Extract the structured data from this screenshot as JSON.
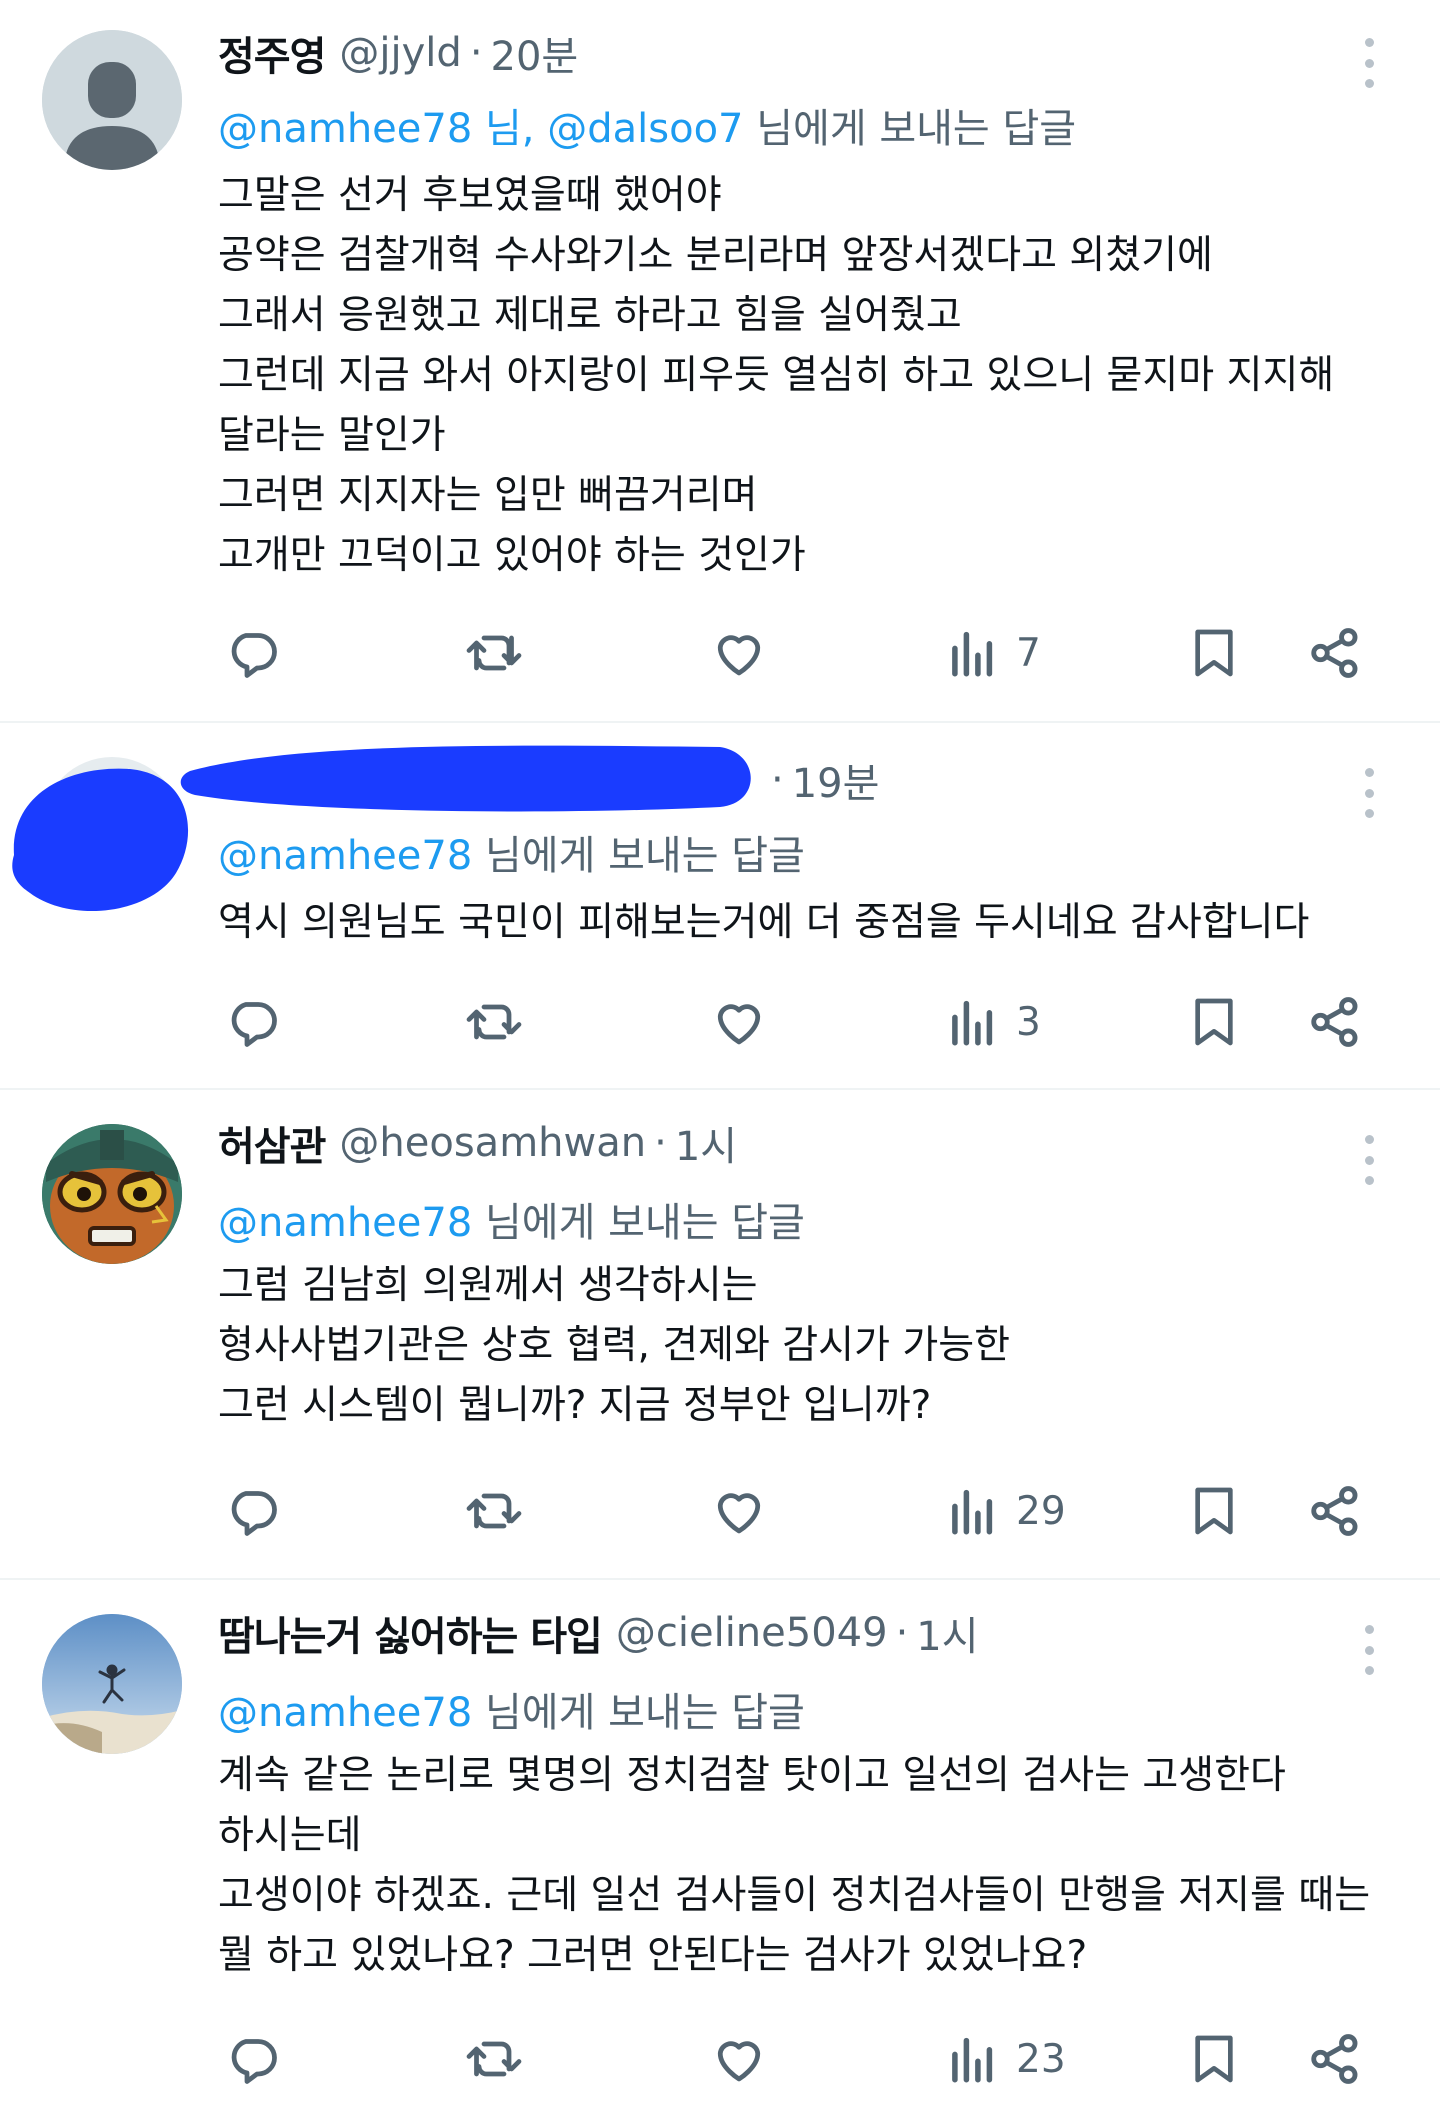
{
  "tweets": [
    {
      "name": "정주영",
      "handle": "@jjyld",
      "time": "20분",
      "reply_mentions": "@namhee78 님, @dalsoo7",
      "reply_suffix": " 님에게 보내는 답글",
      "lines": [
        "그말은 선거 후보였을때 했어야",
        "공약은 검찰개혁 수사와기소 분리라며 앞장서겠다고 외쳤기에",
        "그래서 응원했고 제대로 하라고 힘을 실어줬고",
        "그런데 지금 와서 아지랑이 피우듯 열심히 하고 있으니 묻지마 지지해",
        "달라는 말인가",
        "그러면 지지자는 입만 뻐끔거리며",
        "고개만 끄덕이고 있어야 하는 것인가"
      ],
      "views": "7"
    },
    {
      "name": "",
      "handle": "",
      "time": "19분",
      "reply_mentions": "@namhee78",
      "reply_suffix": " 님에게 보내는 답글",
      "lines": [
        "역시 의원님도 국민이 피해보는거에 더 중점을 두시네요 감사합니다"
      ],
      "views": "3"
    },
    {
      "name": "허삼관",
      "handle": "@heosamhwan",
      "time": "1시",
      "reply_mentions": "@namhee78",
      "reply_suffix": " 님에게 보내는 답글",
      "lines": [
        "그럼 김남희 의원께서 생각하시는",
        "형사사법기관은 상호 협력, 견제와 감시가 가능한",
        "그런 시스템이 뭡니까? 지금 정부안 입니까?"
      ],
      "views": "29"
    },
    {
      "name": "땀나는거 싫어하는 타입",
      "handle": "@cieline5049",
      "time": "1시",
      "reply_mentions": "@namhee78",
      "reply_suffix": " 님에게 보내는 답글",
      "lines": [
        "계속 같은 논리로 몇명의 정치검찰 탓이고 일선의 검사는 고생한다",
        "하시는데",
        "고생이야 하겠죠. 근데 일선 검사들이 정치검사들이 만행을 저지를 때는",
        "뭘 하고 있었나요? 그러면 안된다는 검사가 있었나요?"
      ],
      "views": "23"
    }
  ],
  "separator": "·",
  "colors": {
    "mention": "#1d9bf0",
    "secondary_text": "#536471",
    "primary_text": "#0f1419",
    "redaction": "#1a3cff"
  },
  "icons": [
    "reply-icon",
    "retweet-icon",
    "like-icon",
    "views-icon",
    "bookmark-icon",
    "share-icon",
    "more-icon"
  ]
}
